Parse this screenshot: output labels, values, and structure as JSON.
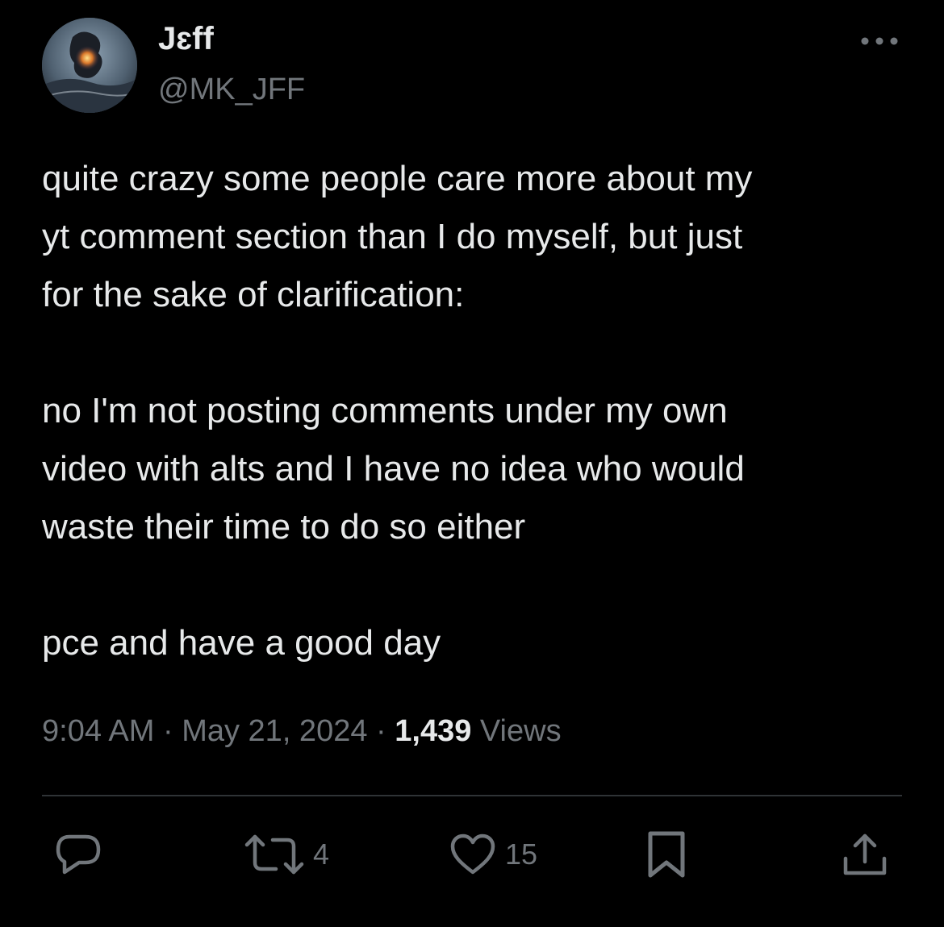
{
  "author": {
    "display_name": "Jɛff",
    "handle": "@MK_JFF"
  },
  "tweet": {
    "paragraphs": [
      "quite crazy some people care more about my\nyt comment section than I do myself, but just\nfor the sake of clarification:",
      "no I'm not posting comments under my own\nvideo with alts and I have no idea who would\nwaste their time to do so either",
      "pce and have a good day"
    ]
  },
  "meta": {
    "time": "9:04 AM",
    "date": "May 21, 2024",
    "separator": " · ",
    "views_count": "1,439",
    "views_label": " Views"
  },
  "actions": {
    "retweet_count": "4",
    "like_count": "15"
  },
  "icons": {
    "more": "more-horizontal-icon",
    "reply": "reply-bubble-icon",
    "retweet": "retweet-icon",
    "like": "heart-icon",
    "bookmark": "bookmark-icon",
    "share": "share-upload-icon"
  },
  "colors": {
    "background": "#000000",
    "text_primary": "#e7e9ea",
    "text_secondary": "#71767b",
    "divider": "#2f3336"
  }
}
